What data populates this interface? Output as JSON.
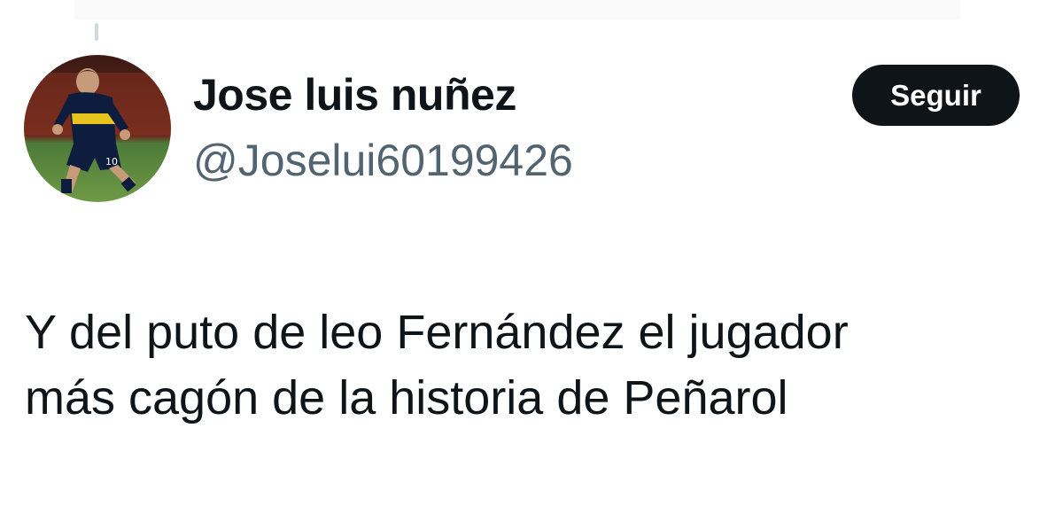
{
  "tweet": {
    "author": {
      "display_name": "Jose luis nuñez",
      "handle": "@Joselui60199426",
      "avatar_icon": "profile-photo-soccer-player"
    },
    "follow_button_label": "Seguir",
    "text_lines": [
      "Y del puto de leo Fernández el jugador",
      "más cagón de la historia de Peñarol"
    ]
  },
  "colors": {
    "text_primary": "#0f1419",
    "text_secondary": "#536471",
    "button_bg": "#0f1419",
    "button_text": "#ffffff"
  }
}
